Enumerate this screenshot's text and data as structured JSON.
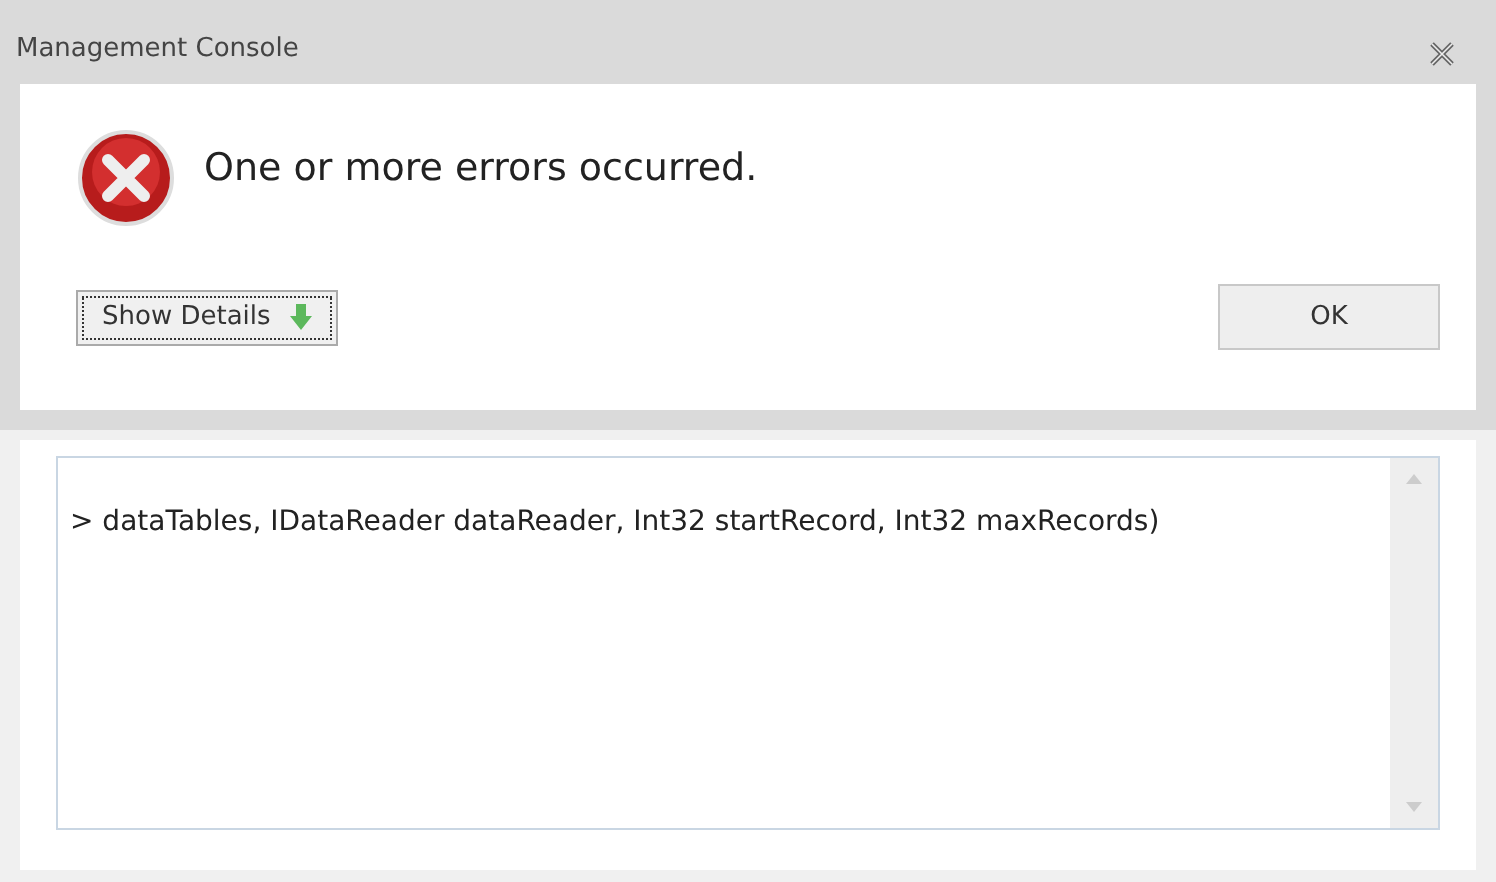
{
  "window": {
    "title": "Management Console"
  },
  "message": "One or more errors occurred.",
  "buttons": [
    {
      "kind": "details",
      "label": "Show Details"
    },
    {
      "kind": "ok",
      "label": "OK"
    }
  ],
  "details": {
    "text": "> dataTables, IDataReader dataReader, Int32 startRecord, Int32 maxRecords)"
  }
}
